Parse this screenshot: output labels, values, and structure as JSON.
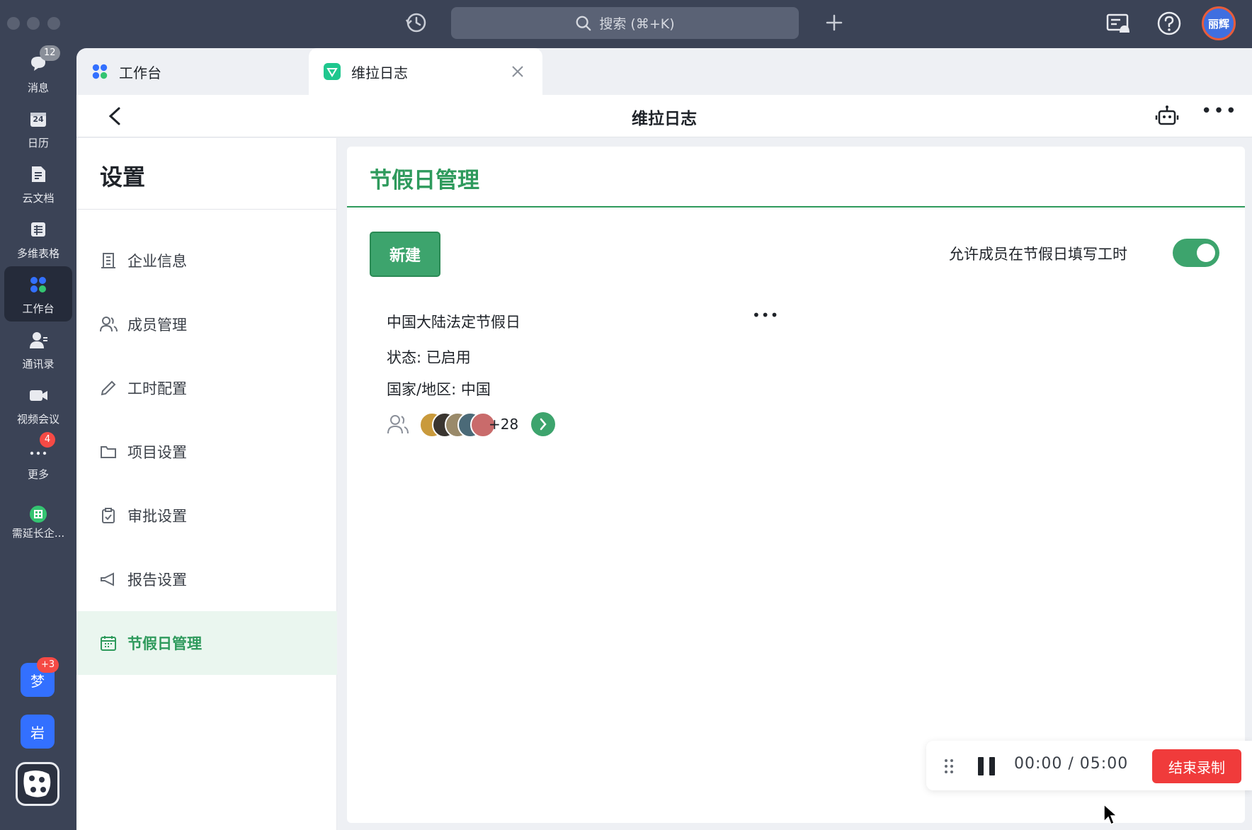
{
  "titlebar": {
    "search_label": "搜索 (⌘+K)",
    "user_name": "丽辉"
  },
  "rail": {
    "items": [
      {
        "label": "消息",
        "badge": "12"
      },
      {
        "label": "日历",
        "icon_text": "24"
      },
      {
        "label": "云文档"
      },
      {
        "label": "多维表格"
      },
      {
        "label": "工作台"
      },
      {
        "label": "通讯录"
      },
      {
        "label": "视频会议"
      },
      {
        "label": "更多",
        "badge": "4"
      },
      {
        "label": "需延长企..."
      }
    ],
    "apps": [
      {
        "label": "梦",
        "badge": "+3"
      },
      {
        "label": "岩"
      }
    ]
  },
  "tabs": [
    {
      "label": "工作台"
    },
    {
      "label": "维拉日志"
    }
  ],
  "header": {
    "title": "维拉日志"
  },
  "settings": {
    "title": "设置",
    "menu": [
      {
        "label": "企业信息",
        "icon": "building-icon"
      },
      {
        "label": "成员管理",
        "icon": "members-icon"
      },
      {
        "label": "工时配置",
        "icon": "pencil-icon"
      },
      {
        "label": "项目设置",
        "icon": "folder-icon"
      },
      {
        "label": "审批设置",
        "icon": "clipboard-icon"
      },
      {
        "label": "报告设置",
        "icon": "megaphone-icon"
      },
      {
        "label": "节假日管理",
        "icon": "calendar-icon",
        "active": true
      }
    ]
  },
  "panel": {
    "title": "节假日管理",
    "new_button": "新建",
    "allow_label": "允许成员在节假日填写工时",
    "allow_enabled": true,
    "card": {
      "name": "中国大陆法定节假日",
      "status": "状态: 已启用",
      "region": "国家/地区: 中国",
      "extra_members": "+28"
    }
  },
  "recorder": {
    "time": "00:00 / 05:00",
    "end_label": "结束录制"
  },
  "colors": {
    "accent_green": "#3da46d",
    "rail_bg": "#3b4356",
    "badge_red": "#f54a45",
    "record_red": "#f03b3b"
  }
}
